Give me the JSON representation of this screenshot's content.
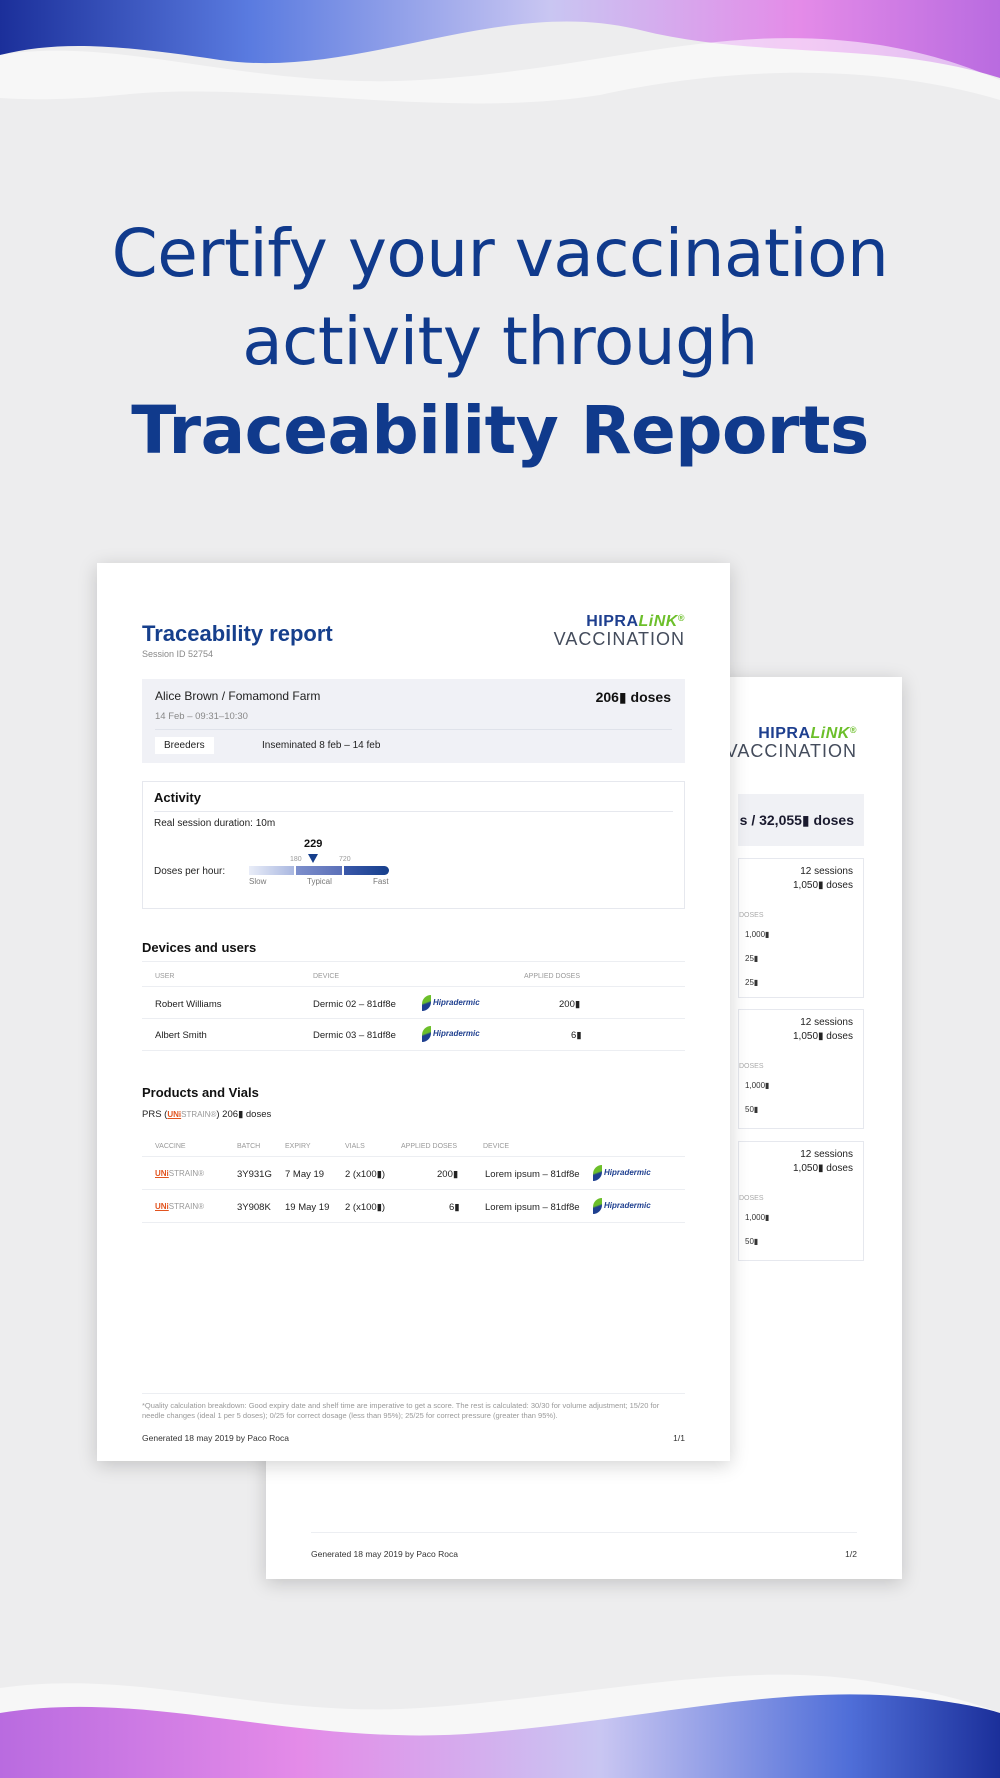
{
  "headline": {
    "line1": "Certify your vaccination",
    "line2": "activity through",
    "line3": "Traceability Reports"
  },
  "colors": {
    "brand_blue": "#103a8c",
    "accent_green": "#6cbf2a",
    "background": "#ededee"
  },
  "logo": {
    "top_left": "HIPRA",
    "top_right": "LiNK",
    "trademark": "®",
    "bottom": "VACCINATION"
  },
  "back_report": {
    "total": "s / 32,055▮ doses",
    "cards": [
      {
        "sessions": "12 sessions",
        "doses": "1,050▮ doses",
        "col_label": "DOSES",
        "values": [
          "1,000▮",
          "25▮",
          "25▮"
        ]
      },
      {
        "sessions": "12 sessions",
        "doses": "1,050▮ doses",
        "col_label": "DOSES",
        "values": [
          "1,000▮",
          "50▮"
        ]
      },
      {
        "sessions": "12 sessions",
        "doses": "1,050▮ doses",
        "col_label": "DOSES",
        "values": [
          "1,000▮",
          "50▮"
        ]
      }
    ],
    "footer": "Generated 18 may 2019 by Paco Roca",
    "page": "1/2"
  },
  "report": {
    "title": "Traceability report",
    "session": "Session ID 52754",
    "summary": {
      "name": "Alice Brown / Fomamond Farm",
      "date": "14 Feb – 09:31–10:30",
      "doses": "206▮ doses",
      "tag": "Breeders",
      "inseminated": "Inseminated  8 feb – 14 feb"
    },
    "activity": {
      "heading": "Activity",
      "duration": "Real session duration: 10m",
      "doses_per_hour_label": "Doses per hour:",
      "value": "229",
      "tick_low": "180",
      "tick_high": "720",
      "labels": [
        "Slow",
        "Typical",
        "Fast"
      ]
    },
    "devices": {
      "heading": "Devices and users",
      "columns": [
        "USER",
        "DEVICE",
        "APPLIED DOSES"
      ],
      "rows": [
        {
          "user": "Robert Williams",
          "device": "Dermic 02 – 81df8e",
          "brand": "Hipradermic",
          "doses": "200▮"
        },
        {
          "user": "Albert Smith",
          "device": "Dermic 03 – 81df8e",
          "brand": "Hipradermic",
          "doses": "6▮"
        }
      ]
    },
    "products": {
      "heading": "Products and Vials",
      "summary_prefix": "PRS  (",
      "summary_suffix": ")    206▮ doses",
      "columns": [
        "VACCINE",
        "BATCH",
        "EXPIRY",
        "VIALS",
        "APPLIED DOSES",
        "DEVICE"
      ],
      "vaccine_brand_u": "UNi",
      "vaccine_brand_s": "STRAIN®",
      "rows": [
        {
          "batch": "3Y931G",
          "expiry": "7 May 19",
          "vials": "2 (x100▮)",
          "doses": "200▮",
          "device": "Lorem ipsum – 81df8e",
          "brand": "Hipradermic"
        },
        {
          "batch": "3Y908K",
          "expiry": "19 May 19",
          "vials": "2 (x100▮)",
          "doses": "6▮",
          "device": "Lorem ipsum – 81df8e",
          "brand": "Hipradermic"
        }
      ]
    },
    "note": "*Quality calculation breakdown: Good expiry date and shelf time are imperative to get a score. The rest is calculated: 30/30 for volume adjustment; 15/20 for needle changes (ideal 1 per 5 doses); 0/25 for correct dosage (less than 95%); 25/25 for correct pressure (greater than 95%).",
    "footer": "Generated 18 may 2019 by Paco Roca",
    "page": "1/1"
  }
}
